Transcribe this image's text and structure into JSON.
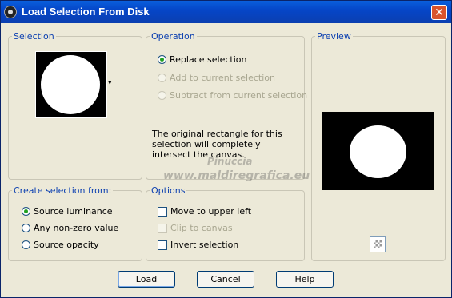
{
  "window": {
    "title": "Load Selection From Disk",
    "close_label": "✕"
  },
  "selection": {
    "legend": "Selection",
    "dropdown_arrow": "▾"
  },
  "operation": {
    "legend": "Operation",
    "options": [
      {
        "label": "Replace selection",
        "checked": true,
        "enabled": true
      },
      {
        "label": "Add to current selection",
        "checked": false,
        "enabled": false
      },
      {
        "label": "Subtract from current selection",
        "checked": false,
        "enabled": false
      }
    ],
    "info": "The original rectangle for this selection will completely intersect the canvas."
  },
  "preview": {
    "legend": "Preview"
  },
  "create": {
    "legend": "Create selection from:",
    "options": [
      {
        "label": "Source luminance",
        "checked": true
      },
      {
        "label": "Any non-zero value",
        "checked": false
      },
      {
        "label": "Source opacity",
        "checked": false
      }
    ]
  },
  "options": {
    "legend": "Options",
    "items": [
      {
        "label": "Move to upper left",
        "checked": false,
        "enabled": true
      },
      {
        "label": "Clip to canvas",
        "checked": false,
        "enabled": false
      },
      {
        "label": "Invert selection",
        "checked": false,
        "enabled": true
      }
    ]
  },
  "watermark": {
    "line1": "Pinuccia",
    "line2": "www.maldiregrafica.eu"
  },
  "buttons": {
    "load": "Load",
    "cancel": "Cancel",
    "help": "Help"
  }
}
